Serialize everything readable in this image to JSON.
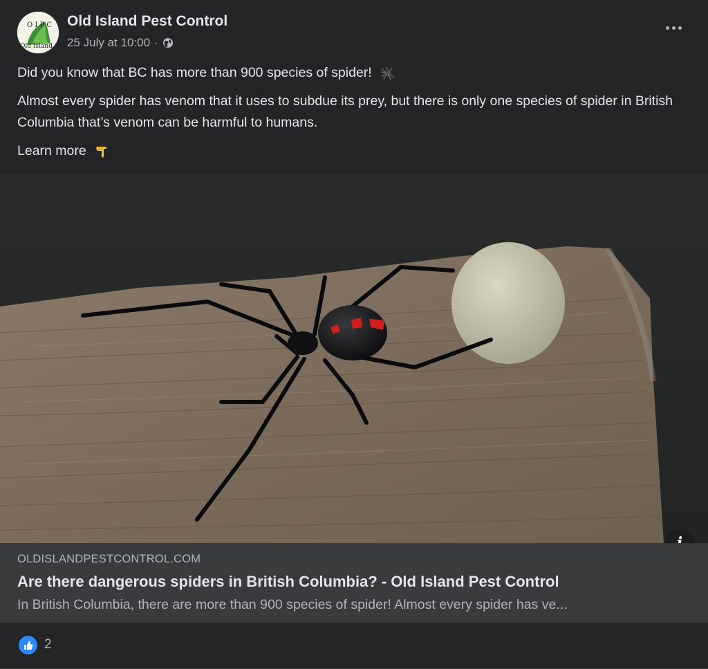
{
  "post": {
    "page_name": "Old Island Pest Control",
    "timestamp": "25 July at 10:00",
    "separator": "·",
    "audience_icon": "globe-icon",
    "more_icon": "more-options-icon",
    "avatar_text": {
      "top": "O I P C",
      "bottom": "Old Island"
    },
    "paragraphs": {
      "p1": "Did you know that BC has more than 900 species of spider!",
      "p2": "Almost every spider has venom that it uses to subdue its prey, but there is only one species of spider in British Columbia that’s venom can be harmful to humans.",
      "p3": "Learn more"
    },
    "emojis": {
      "spider": "spider-emoji",
      "pointing": "backhand-pointing-down-emoji"
    }
  },
  "link_preview": {
    "domain": "OLDISLANDPESTCONTROL.COM",
    "title": "Are there dangerous spiders in British Columbia? - Old Island Pest Control",
    "description": "In British Columbia, there are more than 900 species of spider! Almost every spider has ve...",
    "info_label": "i",
    "image_subject": "black-widow-spider-with-egg-sac-on-wood"
  },
  "reactions": {
    "icon": "like-icon",
    "count": "2"
  },
  "colors": {
    "background": "#242526",
    "link_meta_bg": "#3a3b3c",
    "like_blue": "#2d88ff",
    "text_primary": "#e4e6eb",
    "text_secondary": "#b0b3b8"
  }
}
